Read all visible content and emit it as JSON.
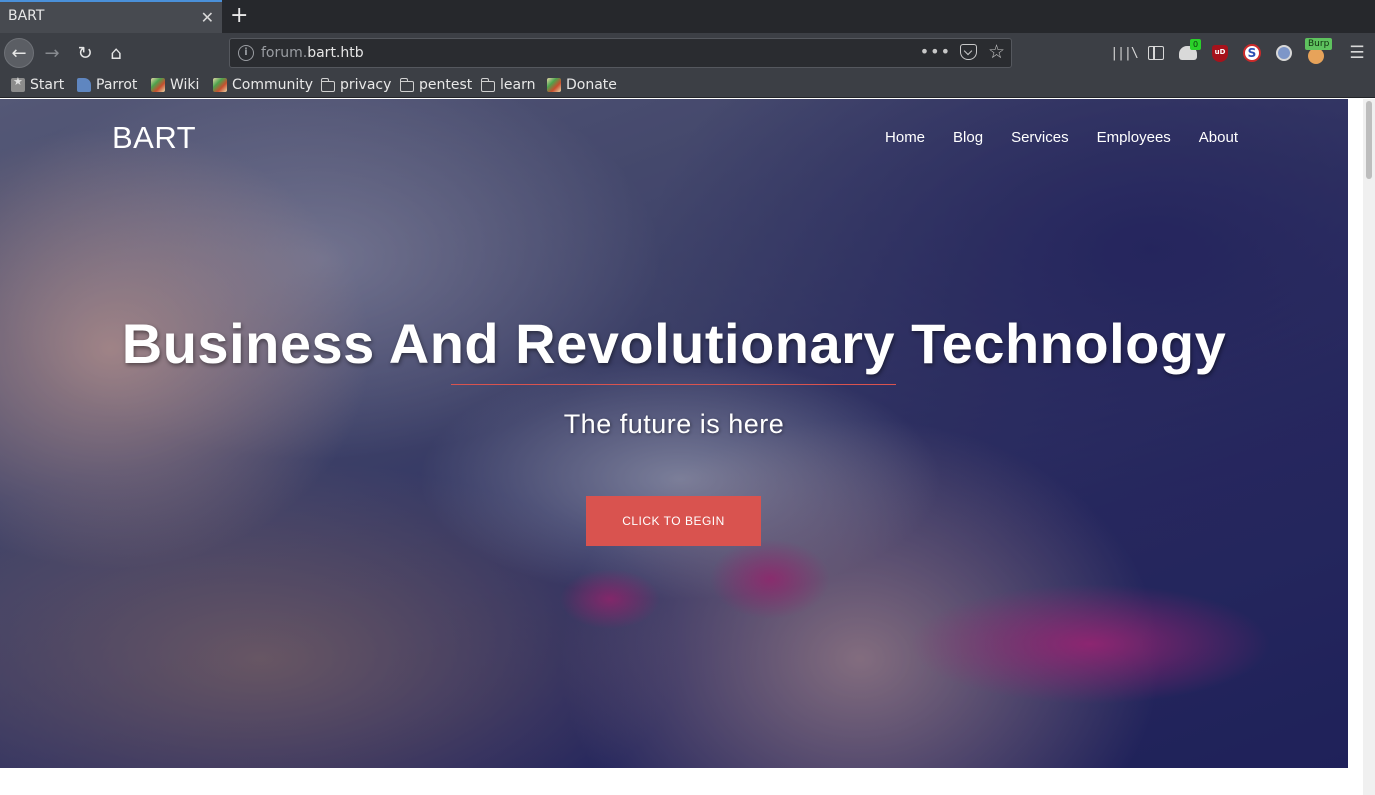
{
  "browser": {
    "tab": {
      "title": "BART",
      "close_glyph": "✕"
    },
    "new_tab_glyph": "+",
    "nav": {
      "back_glyph": "←",
      "forward_glyph": "→",
      "reload_glyph": "↻",
      "home_glyph": "⌂"
    },
    "url": {
      "prefix": "forum.",
      "domain": "bart.htb",
      "info_glyph": "i",
      "more_glyph": "•••",
      "star_glyph": "☆"
    },
    "toolbar": {
      "library_glyph": "|||\\",
      "ext_badge": "0",
      "ublock_text": "uD",
      "s_text": "S",
      "burp_badge": "Burp",
      "menu_glyph": "☰"
    },
    "bookmarks": [
      {
        "label": "Start",
        "icon": "start-icon"
      },
      {
        "label": "Parrot",
        "icon": "parrot-icon"
      },
      {
        "label": "Wiki",
        "icon": "swirl-icon"
      },
      {
        "label": "Community",
        "icon": "swirl-icon"
      },
      {
        "label": "privacy",
        "icon": "folder-icon"
      },
      {
        "label": "pentest",
        "icon": "folder-icon"
      },
      {
        "label": "learn",
        "icon": "folder-icon"
      },
      {
        "label": "Donate",
        "icon": "swirl-icon"
      }
    ]
  },
  "site": {
    "brand": "BART",
    "nav": [
      "Home",
      "Blog",
      "Services",
      "Employees",
      "About"
    ],
    "hero": {
      "title": "Business And Revolutionary Technology",
      "subtitle": "The future is here",
      "cta": "CLICK TO BEGIN"
    },
    "colors": {
      "accent": "#d9534f",
      "hero_overlay": "#232660"
    }
  }
}
